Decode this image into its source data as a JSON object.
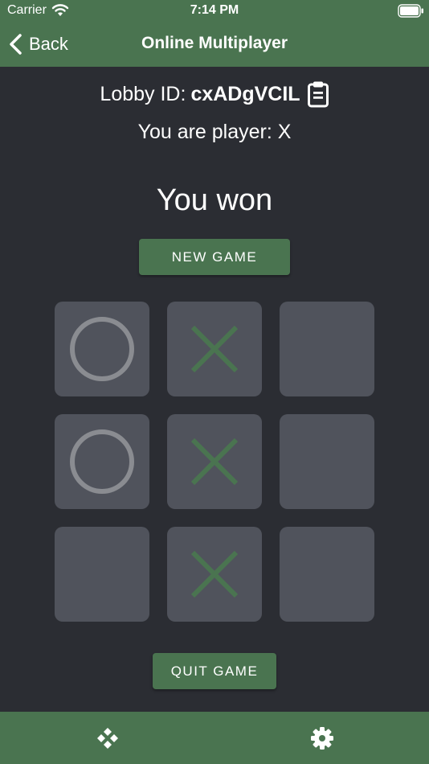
{
  "status_bar": {
    "carrier": "Carrier",
    "time": "7:14 PM"
  },
  "nav": {
    "back_label": "Back",
    "title": "Online Multiplayer"
  },
  "lobby": {
    "label": "Lobby ID:",
    "id": "cxADgVCIL"
  },
  "player_text": "You are player: X",
  "result_text": "You won",
  "buttons": {
    "new_game": "NEW GAME",
    "quit_game": "QUIT GAME"
  },
  "board": [
    [
      "O",
      "X",
      ""
    ],
    [
      "O",
      "X",
      ""
    ],
    [
      "",
      "X",
      ""
    ]
  ],
  "colors": {
    "brand": "#4a7450",
    "background": "#2b2d33",
    "cell": "#50535c",
    "x_mark": "#4a7450",
    "o_mark": "#8a8c91"
  },
  "tabs": [
    {
      "icon": "gamepad-icon"
    },
    {
      "icon": "gear-icon"
    }
  ]
}
